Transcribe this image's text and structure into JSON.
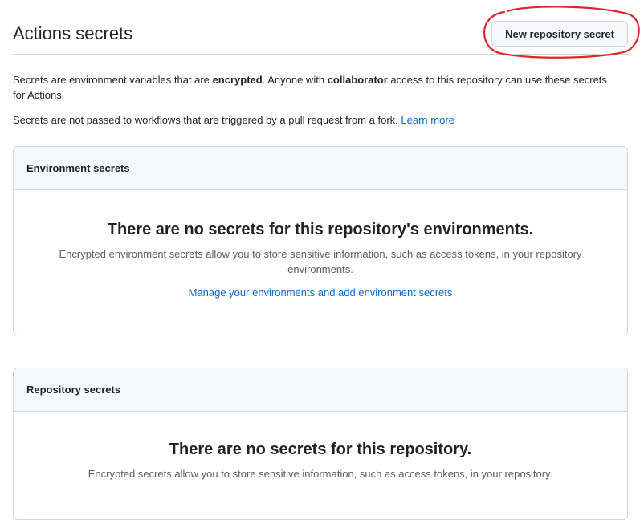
{
  "header": {
    "title": "Actions secrets",
    "new_secret_button": "New repository secret"
  },
  "intro": {
    "line1_part1": "Secrets are environment variables that are ",
    "line1_bold1": "encrypted",
    "line1_part2": ". Anyone with ",
    "line1_bold2": "collaborator",
    "line1_part3": " access to this repository can use these secrets for Actions.",
    "line2_text": "Secrets are not passed to workflows that are triggered by a pull request from a fork. ",
    "line2_link": "Learn more"
  },
  "environment_secrets": {
    "header": "Environment secrets",
    "blank_title": "There are no secrets for this repository's environments.",
    "blank_text": "Encrypted environment secrets allow you to store sensitive information, such as access tokens, in your repository environments.",
    "blank_link": "Manage your environments and add environment secrets"
  },
  "repository_secrets": {
    "header": "Repository secrets",
    "blank_title": "There are no secrets for this repository.",
    "blank_text": "Encrypted secrets allow you to store sensitive information, such as access tokens, in your repository."
  },
  "colors": {
    "link": "#0969da",
    "annotation": "#e0262b",
    "border": "#d0d7de",
    "header_bg": "#f6f8fa"
  }
}
